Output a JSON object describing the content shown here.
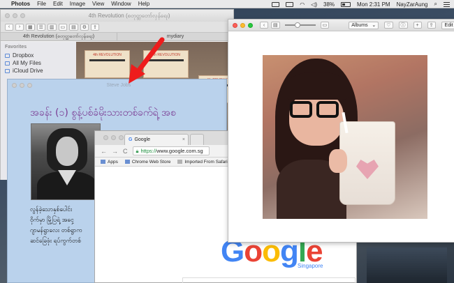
{
  "menubar": {
    "app_name": "Photos",
    "menus": [
      "File",
      "Edit",
      "Image",
      "View",
      "Window",
      "Help"
    ],
    "battery": "38%",
    "clock": "Mon 2:31 PM",
    "user": "NayZarAung"
  },
  "finder": {
    "title": "4th Revolution (စတုတ္ထတော်လှန်ရေး)",
    "tabs": [
      "4th Revolution (စတုတ္ထတော်လှန်ရေး)",
      "mydiary"
    ],
    "sidebar_heading": "Favorites",
    "sidebar_items": [
      "Dropbox",
      "All My Files",
      "iCloud Drive"
    ],
    "poster_text": "4th REVOLUTION"
  },
  "document": {
    "title": "Steve Jobs",
    "heading": "အခန်း (၁) စွန့်ပစ်ခံမိုးသားတစ်ခက်ရဲ့ အစ",
    "paragraph_lines": [
      "လွန်ခဲ့သောနှစ်ပေါင်း",
      "ဝိုက်မှာ မြို့ပြရဲ့ အငှေ့",
      "ဂျာမန်ရွာလေး တစ်ရွာက",
      "ဆင်ခြေဖုံး ရပ်ကွက်တစ်"
    ]
  },
  "chrome": {
    "tab_title": "Google",
    "url_prefix": "https://",
    "url_rest": "www.google.com.sg",
    "bookmarks": [
      "Apps",
      "Chrome Web Store",
      "Imported From Safari"
    ],
    "logo": [
      "G",
      "o",
      "o",
      "g",
      "l",
      "e"
    ],
    "region": "Singapore"
  },
  "photos": {
    "albums_label": "Albums",
    "edit_label": "Edit"
  },
  "colors": {
    "heading": "#7a3b93",
    "doc_bg": "#bad2ec",
    "arrow": "#ee1c1c"
  }
}
